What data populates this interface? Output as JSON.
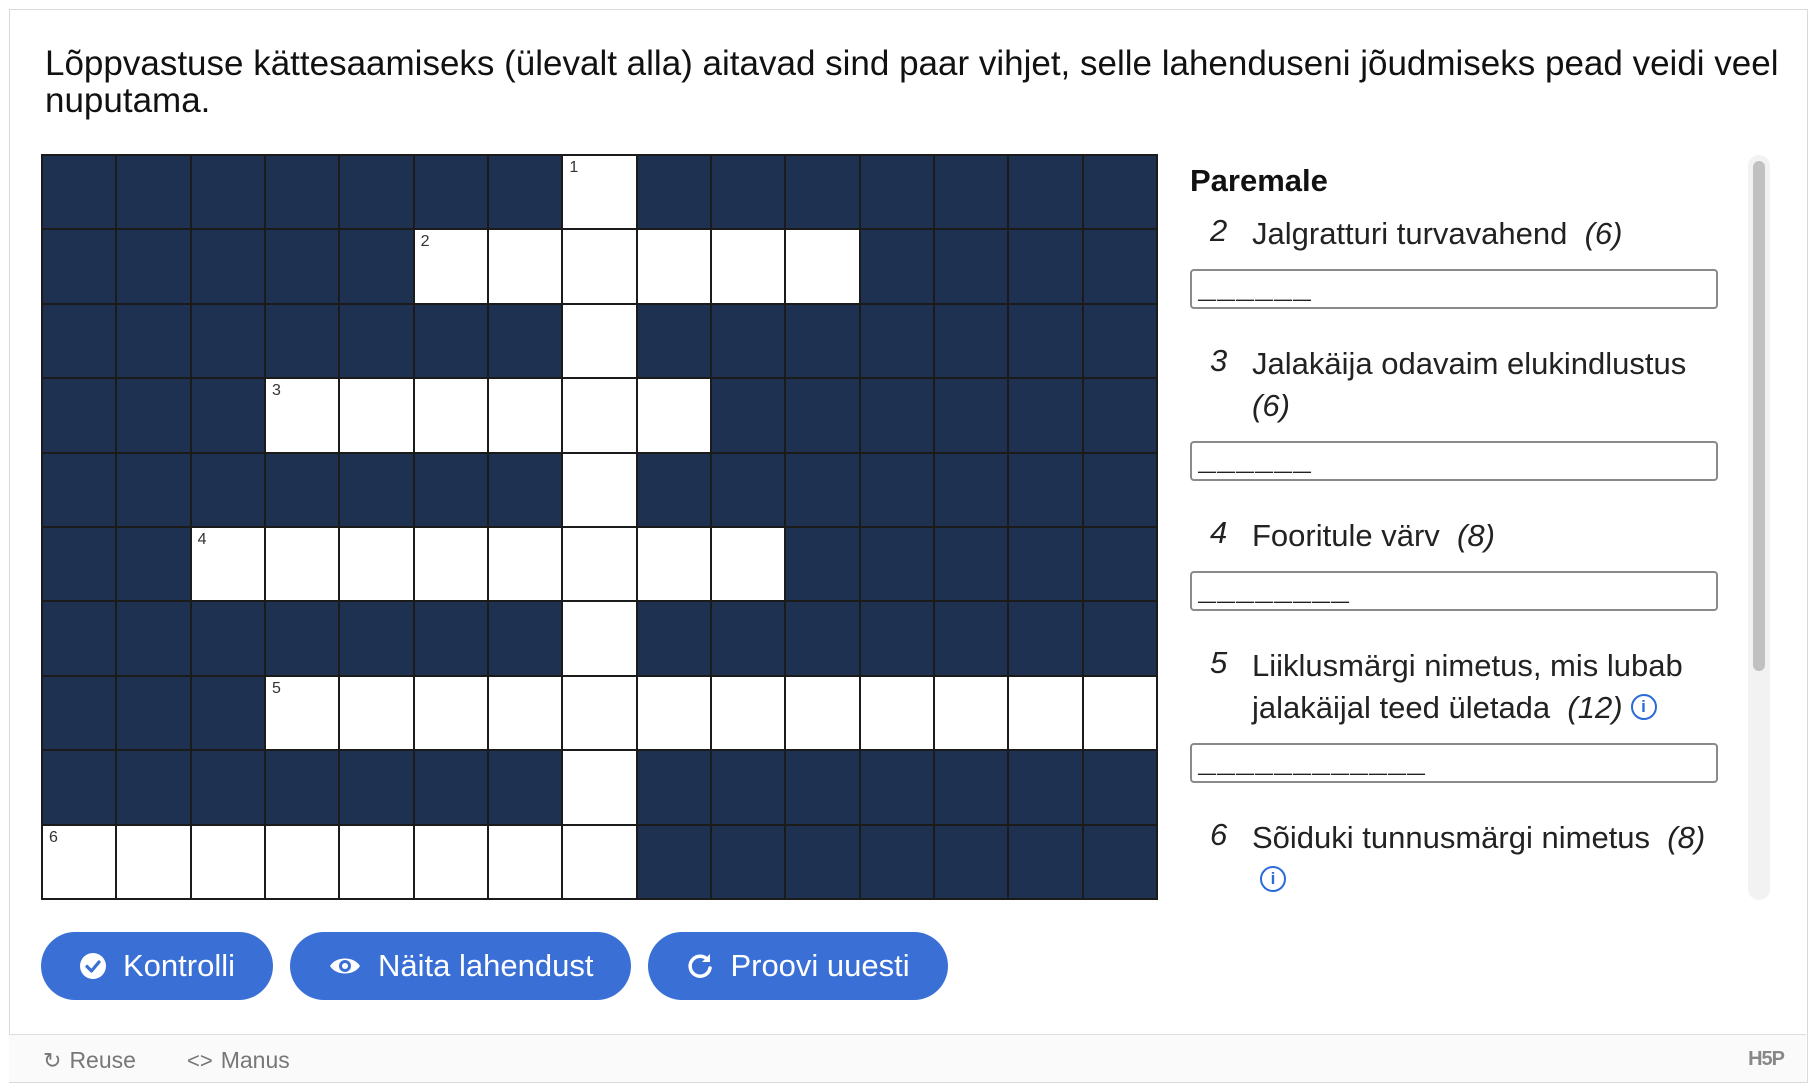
{
  "intro": "Lõppvastuse kättesaamiseks (ülevalt alla) aitavad sind paar vihjet, selle lahenduseni jõudmiseks pead veidi veel nuputama.",
  "grid": {
    "rows": [
      "#######.#######",
      "#####......####",
      "#######.#######",
      "###......######",
      "#######.#######",
      "##........#####",
      "#######.#######",
      "###............",
      "#######.#######",
      "........#######"
    ],
    "numbers": [
      {
        "row": 0,
        "col": 7,
        "n": "1"
      },
      {
        "row": 1,
        "col": 5,
        "n": "2"
      },
      {
        "row": 3,
        "col": 3,
        "n": "3"
      },
      {
        "row": 5,
        "col": 2,
        "n": "4"
      },
      {
        "row": 7,
        "col": 3,
        "n": "5"
      },
      {
        "row": 9,
        "col": 0,
        "n": "6"
      }
    ]
  },
  "clues": {
    "heading": "Paremale",
    "items": [
      {
        "number": "2",
        "text": "Jalgratturi turvavahend",
        "length": "(6)",
        "info": false,
        "placeholder": "______"
      },
      {
        "number": "3",
        "text": "Jalakäija odavaim elukindlustus",
        "length": "(6)",
        "info": false,
        "placeholder": "______"
      },
      {
        "number": "4",
        "text": "Fooritule värv",
        "length": "(8)",
        "info": false,
        "placeholder": "________"
      },
      {
        "number": "5",
        "text": "Liiklusmärgi nimetus, mis lubab jalakäijal teed ületada",
        "length": "(12)",
        "info": true,
        "placeholder": "____________"
      },
      {
        "number": "6",
        "text": "Sõiduki tunnusmärgi nimetus",
        "length": "(8)",
        "info": true,
        "placeholder": "________"
      }
    ]
  },
  "buttons": {
    "check": "Kontrolli",
    "show": "Näita lahendust",
    "retry": "Proovi uuesti"
  },
  "footer": {
    "reuse": "Reuse",
    "embed": "Manus",
    "logo": "H5P"
  },
  "colors": {
    "dark_cell": "#1f3150",
    "button": "#3a6fd6"
  }
}
